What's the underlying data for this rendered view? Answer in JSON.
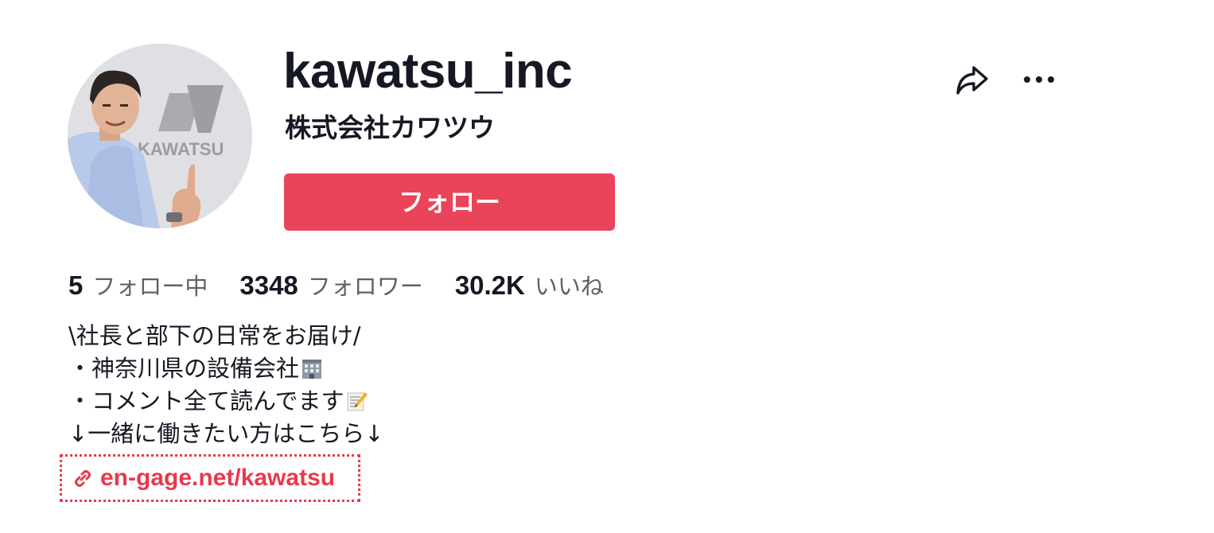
{
  "profile": {
    "username": "kawatsu_inc",
    "nickname": "株式会社カワツウ",
    "follow_label": "フォロー",
    "avatar_logo_text": "KAWATSU"
  },
  "actions": {
    "share_icon": "share-arrow-icon",
    "more_icon": "more-horizontal-icon"
  },
  "stats": [
    {
      "value": "5",
      "label": "フォロー中"
    },
    {
      "value": "3348",
      "label": "フォロワー"
    },
    {
      "value": "30.2K",
      "label": "いいね"
    }
  ],
  "bio": {
    "lines": [
      "\\社長と部下の日常をお届け/",
      "・神奈川県の設備会社",
      "・コメント全て読んでます",
      "↓一緒に働きたい方はこちら↓"
    ],
    "emojis": [
      "office-building-emoji",
      "memo-emoji"
    ]
  },
  "link": {
    "icon": "link-icon",
    "text": "en-gage.net/kawatsu"
  },
  "colors": {
    "accent": "#ea445a",
    "link": "#e7394e",
    "text": "#161823",
    "secondary_text": "#5f6068"
  }
}
